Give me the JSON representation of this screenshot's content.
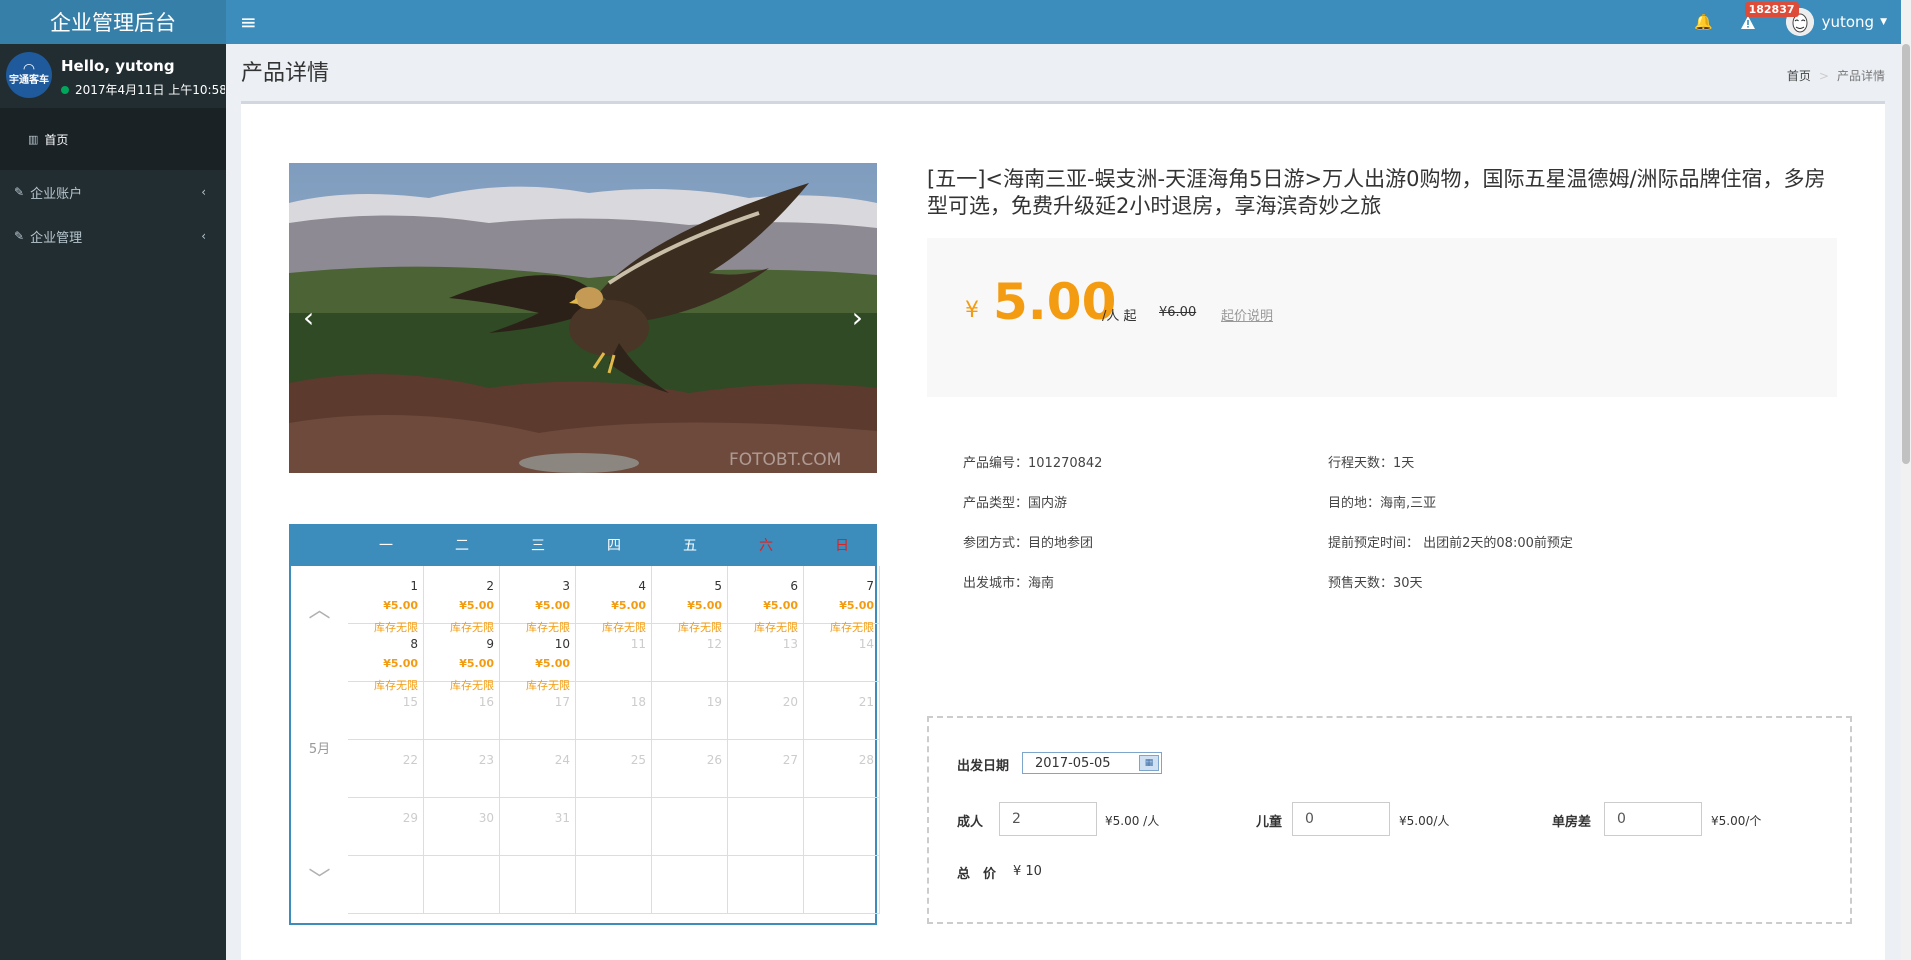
{
  "app": {
    "title": "企业管理后台"
  },
  "topbar": {
    "notifications_badge": "182837",
    "username": "yutong"
  },
  "sidebar": {
    "brand_text": "宇通客车",
    "greeting": "Hello, yutong",
    "status_time": "2017年4月11日 上午10:58:",
    "items": [
      {
        "label": "首页"
      },
      {
        "label": "企业账户"
      },
      {
        "label": "企业管理"
      }
    ]
  },
  "page": {
    "title": "产品详情",
    "breadcrumb": {
      "home": "首页",
      "separator": ">",
      "current": "产品详情"
    }
  },
  "carousel": {
    "watermark": "FOTOBT.COM"
  },
  "product": {
    "title": "[五一]<海南三亚-蜈支洲-天涯海角5日游>万人出游0购物，国际五星温德姆/洲际品牌住宿，多房型可选，免费升级延2小时退房，享海滨奇妙之旅",
    "price": {
      "currency": "¥",
      "value": "5.00",
      "unit": "/人 起",
      "original": "¥6.00",
      "explain": "起价说明"
    },
    "info": [
      {
        "text": "产品编号：101270842"
      },
      {
        "text": "行程天数：1天"
      },
      {
        "text": "产品类型：国内游"
      },
      {
        "text": "目的地：海南,三亚"
      },
      {
        "text": "参团方式：目的地参团"
      },
      {
        "text": "提前预定时间： 出团前2天的08:00前预定"
      },
      {
        "text": "出发城市：海南"
      },
      {
        "text": "预售天数：30天"
      }
    ]
  },
  "calendar": {
    "month": "5月",
    "weekdays": [
      "一",
      "二",
      "三",
      "四",
      "五",
      "六",
      "日"
    ],
    "price_label": "¥5.00",
    "stock_label": "库存无限",
    "available_days": 10,
    "days_in_month": 31
  },
  "booking": {
    "date_label": "出发日期",
    "date_value": "2017-05-05",
    "adult_label": "成人",
    "adult_value": "2",
    "adult_price": "¥5.00 /人",
    "child_label": "儿童",
    "child_value": "0",
    "child_price": "¥5.00/人",
    "single_label": "单房差",
    "single_value": "0",
    "single_price": "¥5.00/个",
    "total_label": "总　价",
    "total_value": "¥ 10"
  },
  "colors": {
    "brand": "#3c8dbc",
    "sidebar": "#222d32",
    "price": "#f39c12"
  }
}
